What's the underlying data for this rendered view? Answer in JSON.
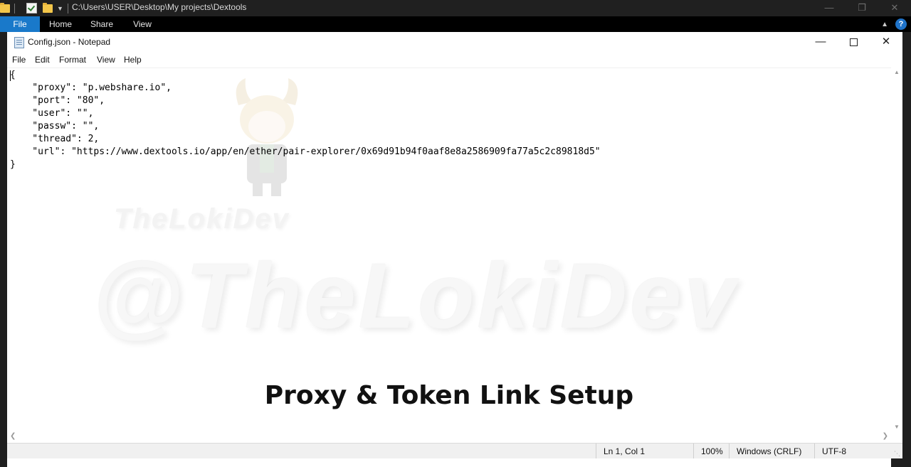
{
  "explorer": {
    "path": "C:\\Users\\USER\\Desktop\\My projects\\Dextools",
    "tabs": [
      {
        "label": "File"
      },
      {
        "label": "Home"
      },
      {
        "label": "Share"
      },
      {
        "label": "View"
      }
    ],
    "help_label": "?"
  },
  "notepad": {
    "title": "Config.json - Notepad",
    "menu": [
      "File",
      "Edit",
      "Format",
      "View",
      "Help"
    ],
    "content": "{\n    \"proxy\": \"p.webshare.io\",\n    \"port\": \"80\",\n    \"user\": \"\",\n    \"passw\": \"\",\n    \"thread\": 2,\n    \"url\": \"https://www.dextools.io/app/en/ether/pair-explorer/0x69d91b94f0aaf8e8a2586909fa77a5c2c89818d5\"\n}",
    "status": {
      "position": "Ln 1, Col 1",
      "zoom": "100%",
      "line_ending": "Windows (CRLF)",
      "encoding": "UTF-8"
    }
  },
  "overlay": {
    "watermark_small": "TheLokiDev",
    "watermark_big": "@TheLokiDev",
    "caption": "Proxy & Token Link Setup"
  },
  "colors": {
    "file_tab": "#1979ca",
    "explorer_bg": "#202020"
  }
}
